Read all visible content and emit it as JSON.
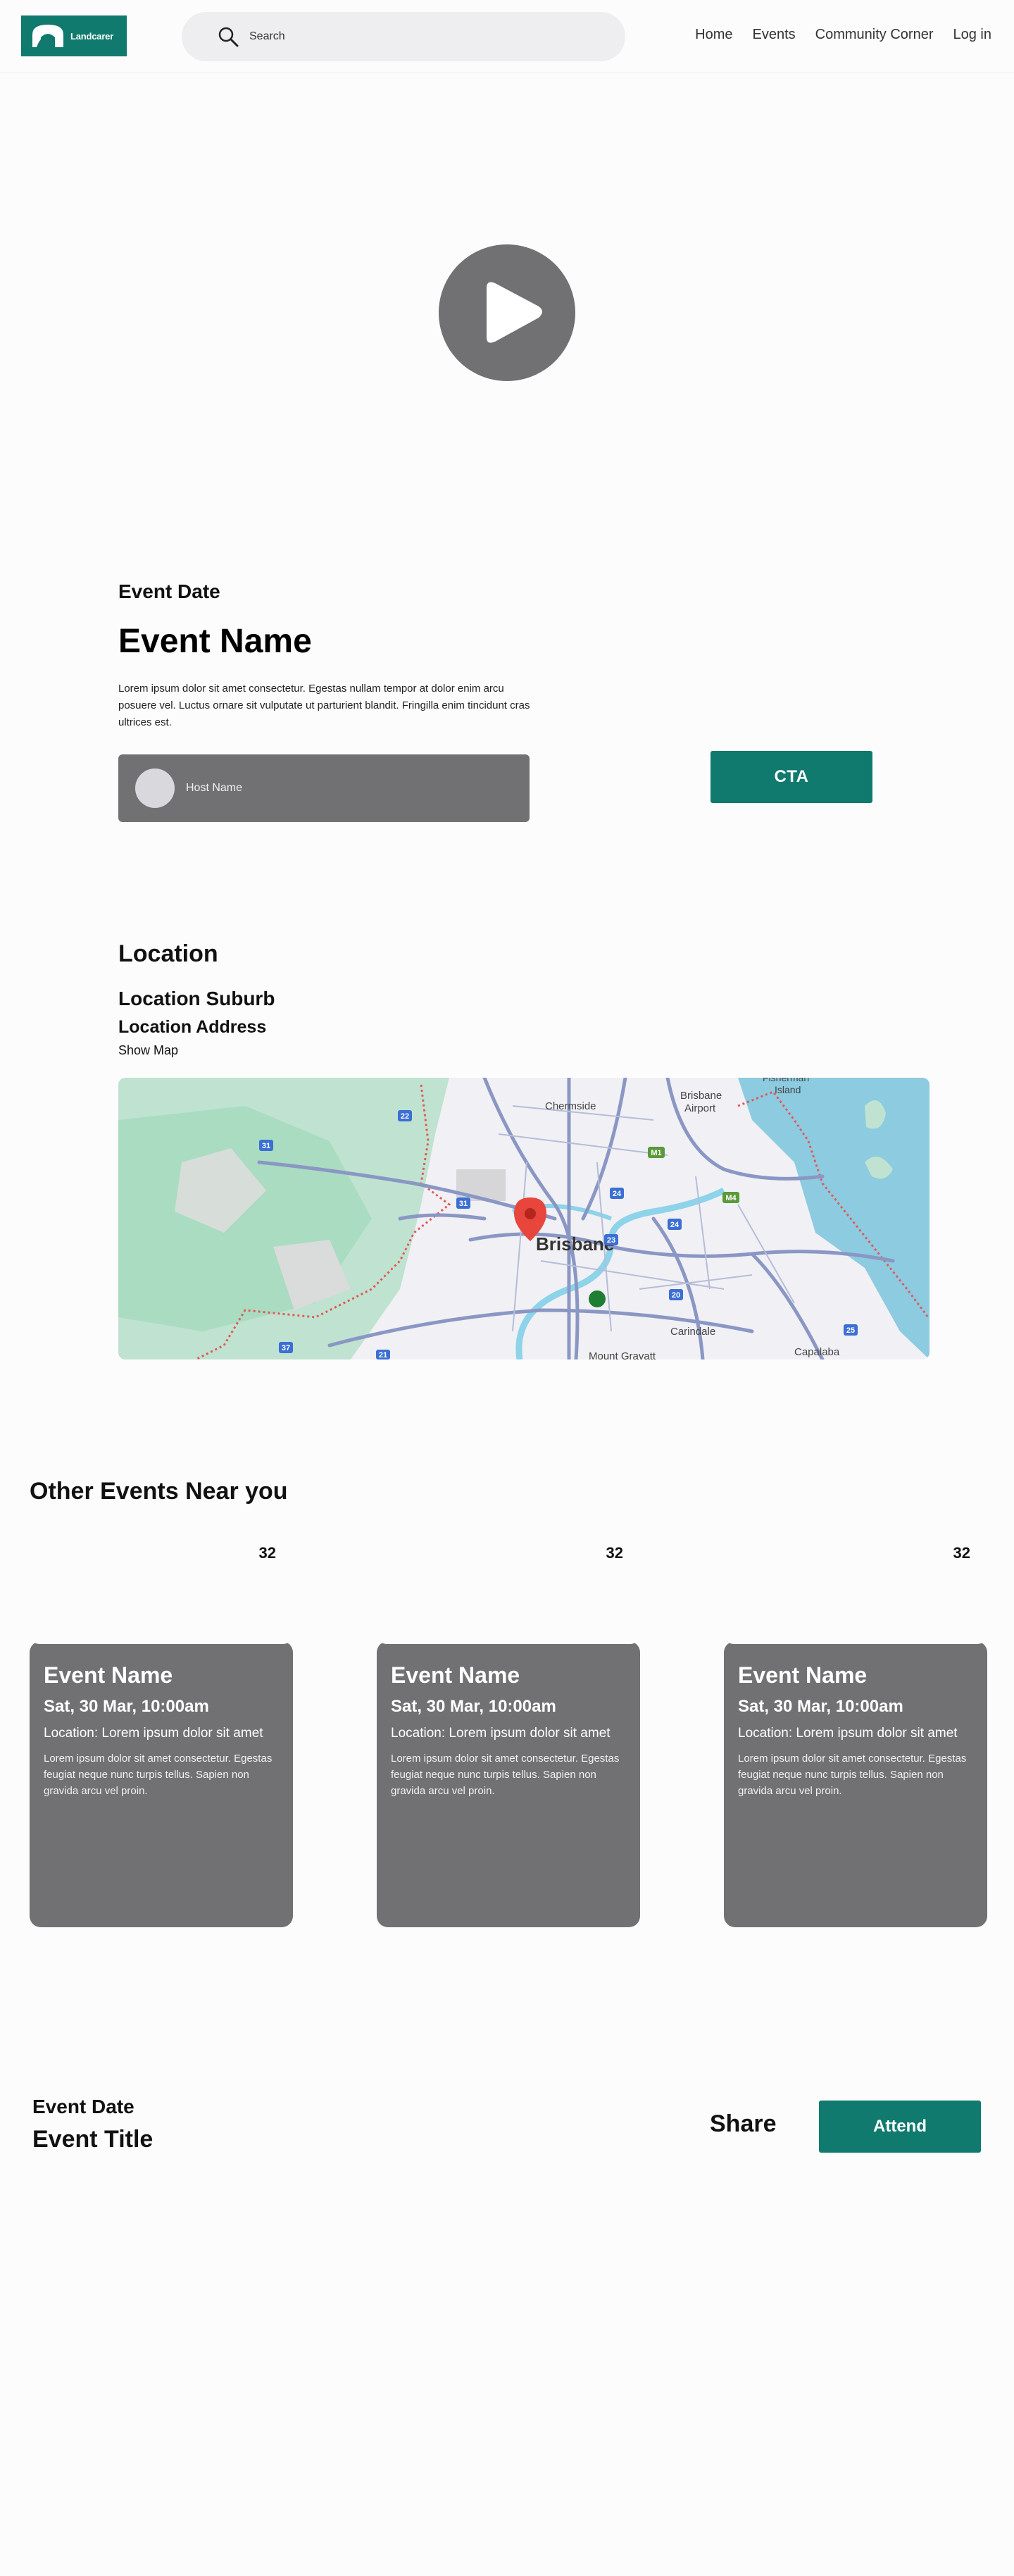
{
  "header": {
    "logo_text": "Landcarer",
    "search_placeholder": "Search",
    "nav": [
      "Home",
      "Events",
      "Community Corner",
      "Log in"
    ]
  },
  "event": {
    "date": "Event Date",
    "name": "Event Name",
    "description": "Lorem ipsum dolor sit amet consectetur. Egestas nullam tempor at dolor enim arcu posuere vel. Luctus ornare sit vulputate ut parturient blandit. Fringilla enim tincidunt cras ultrices est.",
    "host_name": "Host Name",
    "cta_label": "CTA"
  },
  "location": {
    "title": "Location",
    "suburb": "Location Suburb",
    "address": "Location Address",
    "show_map": "Show Map",
    "map_labels": [
      "Chermside",
      "Brisbane Airport",
      "Fisherman Island",
      "Brisbane",
      "Carindale",
      "Mount Gravatt",
      "Capalaba"
    ],
    "road_shields": [
      "31",
      "22",
      "M1",
      "M4",
      "24",
      "23",
      "24",
      "20",
      "25",
      "37",
      "21"
    ]
  },
  "other_events": {
    "title": "Other Events Near you",
    "cards": [
      {
        "count": "32",
        "name": "Event Name",
        "date": "Sat, 30 Mar, 10:00am",
        "location": "Location: Lorem ipsum dolor sit amet",
        "description": "Lorem ipsum dolor sit amet consectetur. Egestas feugiat neque nunc turpis tellus. Sapien non gravida arcu vel proin."
      },
      {
        "count": "32",
        "name": "Event Name",
        "date": "Sat, 30 Mar, 10:00am",
        "location": "Location: Lorem ipsum dolor sit amet",
        "description": "Lorem ipsum dolor sit amet consectetur. Egestas feugiat neque nunc turpis tellus. Sapien non gravida arcu vel proin."
      },
      {
        "count": "32",
        "name": "Event Name",
        "date": "Sat, 30 Mar, 10:00am",
        "location": "Location: Lorem ipsum dolor sit amet",
        "description": "Lorem ipsum dolor sit amet consectetur. Egestas feugiat neque nunc turpis tellus. Sapien non gravida arcu vel proin."
      }
    ]
  },
  "footer_bar": {
    "date": "Event Date",
    "title": "Event Title",
    "share_label": "Share",
    "attend_label": "Attend"
  },
  "colors": {
    "brand": "#0f7a6d",
    "card_bg": "#717073",
    "play_button": "#717073"
  }
}
